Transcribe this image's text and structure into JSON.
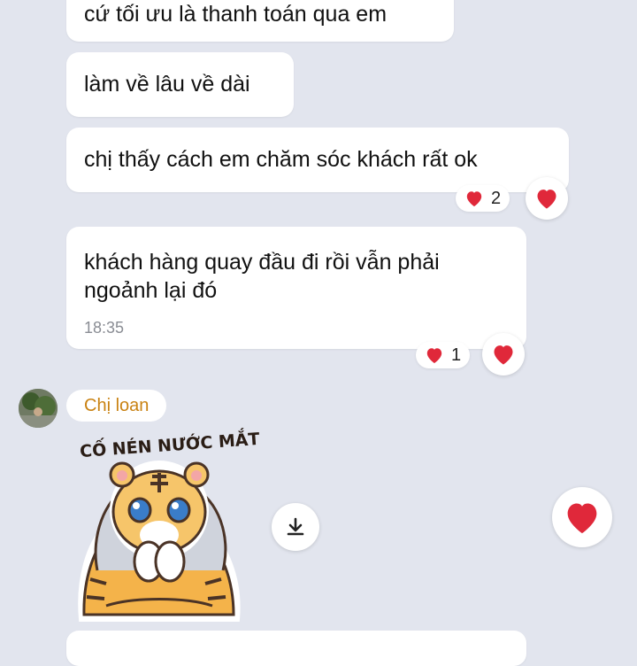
{
  "messages": [
    {
      "text": "cứ tối ưu là thanh toán qua em"
    },
    {
      "text": "làm về lâu về dài"
    },
    {
      "text": "chị thấy cách em chăm sóc khách rất ok",
      "reaction_count": "2"
    },
    {
      "text_line1": "khách hàng quay đầu đi rồi vẫn phải",
      "text_line2": "ngoảnh lại đó",
      "time": "18:35",
      "reaction_count": "1"
    }
  ],
  "sender": {
    "name": "Chị loan"
  },
  "sticker": {
    "caption": "CỐ NÉN NƯỚC MẮT"
  },
  "icons": {
    "reaction": "heart-icon",
    "download": "download-icon"
  },
  "colors": {
    "background": "#e2e5ee",
    "heart": "#e0283a",
    "sender_name": "#c98212"
  }
}
